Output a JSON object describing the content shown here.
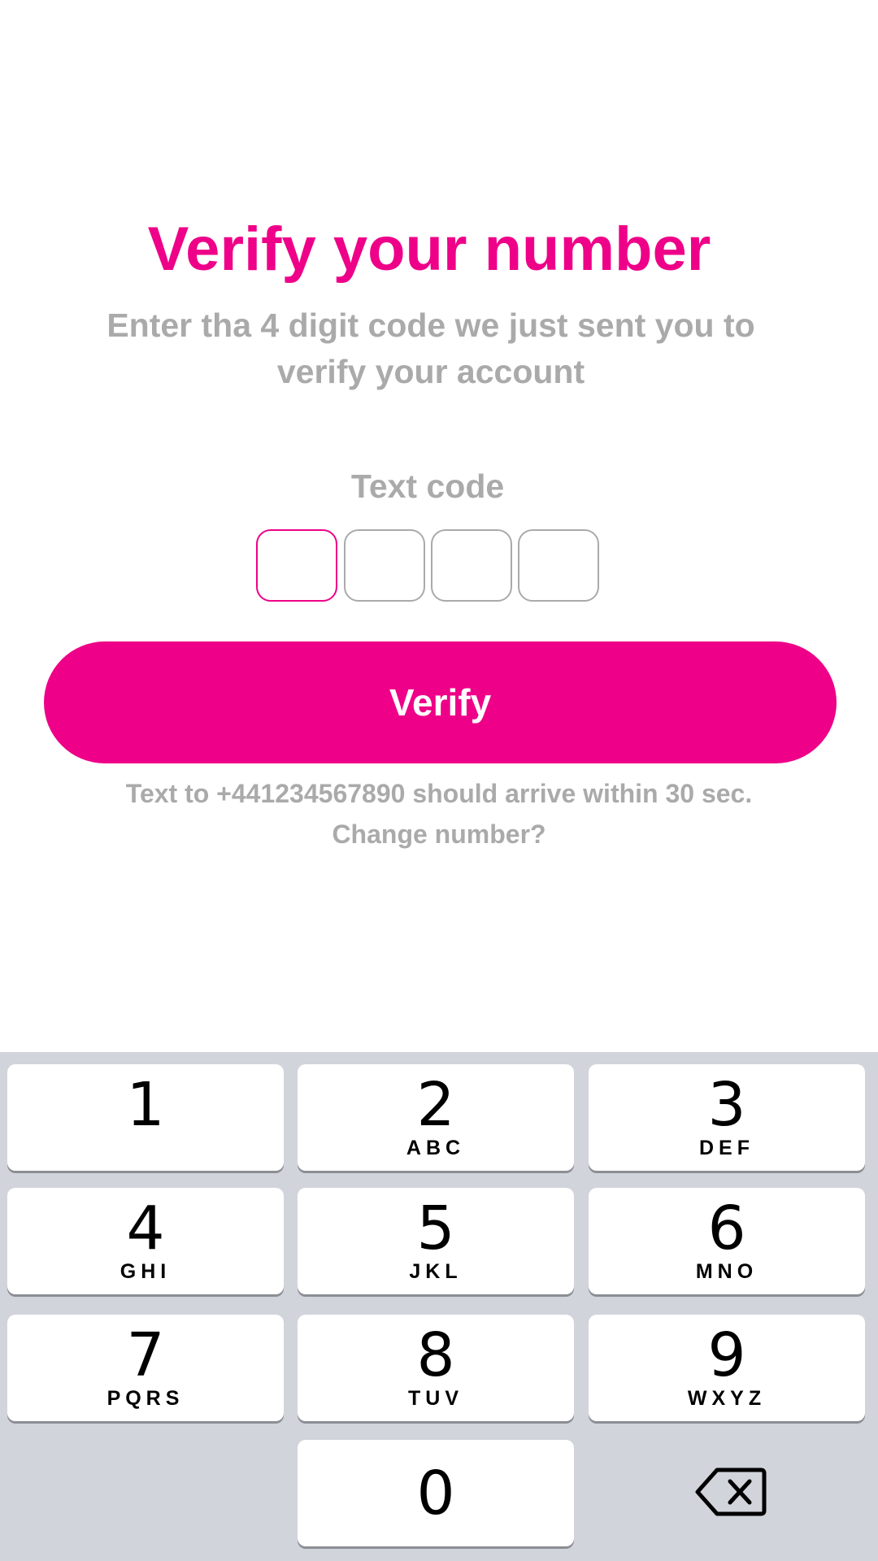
{
  "header": {
    "title": "Verify your number",
    "subtitle": "Enter tha 4 digit code we just sent you to verify your account"
  },
  "code": {
    "label": "Text code",
    "digits": [
      "",
      "",
      "",
      ""
    ]
  },
  "verify_button": {
    "label": "Verify"
  },
  "footer": {
    "info": "Text to +441234567890 should arrive within 30 sec.",
    "change_number": "Change number?"
  },
  "keyboard": {
    "keys": [
      {
        "digit": "1",
        "letters": ""
      },
      {
        "digit": "2",
        "letters": "ABC"
      },
      {
        "digit": "3",
        "letters": "DEF"
      },
      {
        "digit": "4",
        "letters": "GHI"
      },
      {
        "digit": "5",
        "letters": "JKL"
      },
      {
        "digit": "6",
        "letters": "MNO"
      },
      {
        "digit": "7",
        "letters": "PQRS"
      },
      {
        "digit": "8",
        "letters": "TUV"
      },
      {
        "digit": "9",
        "letters": "WXYZ"
      },
      {
        "digit": "0",
        "letters": ""
      }
    ],
    "delete_icon": "backspace-icon"
  },
  "colors": {
    "accent": "#ee0088",
    "muted_text": "#aaaaaa",
    "keyboard_bg": "#d1d4db"
  }
}
